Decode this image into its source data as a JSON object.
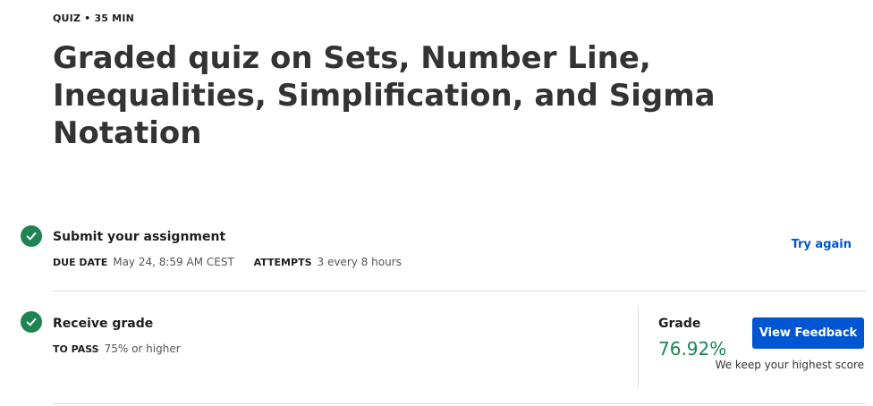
{
  "header": {
    "meta": "QUIZ • 35 MIN",
    "title": "Graded quiz on Sets, Number Line, Inequalities, Simplification, and Sigma Notation"
  },
  "steps": [
    {
      "title": "Submit your assignment",
      "status_icon": "check-circle-icon",
      "details": [
        {
          "key": "DUE DATE",
          "value": "May 24, 8:59 AM CEST"
        },
        {
          "key": "ATTEMPTS",
          "value": "3 every 8 hours"
        }
      ],
      "action": "Try again"
    },
    {
      "title": "Receive grade",
      "status_icon": "check-circle-icon",
      "details": [
        {
          "key": "TO PASS",
          "value": "75% or higher"
        }
      ]
    }
  ],
  "grade": {
    "label": "Grade",
    "value": "76.92%",
    "button": "View Feedback",
    "note": "We keep your highest score"
  },
  "colors": {
    "success": "#1f8354",
    "primary": "#0056d2"
  }
}
